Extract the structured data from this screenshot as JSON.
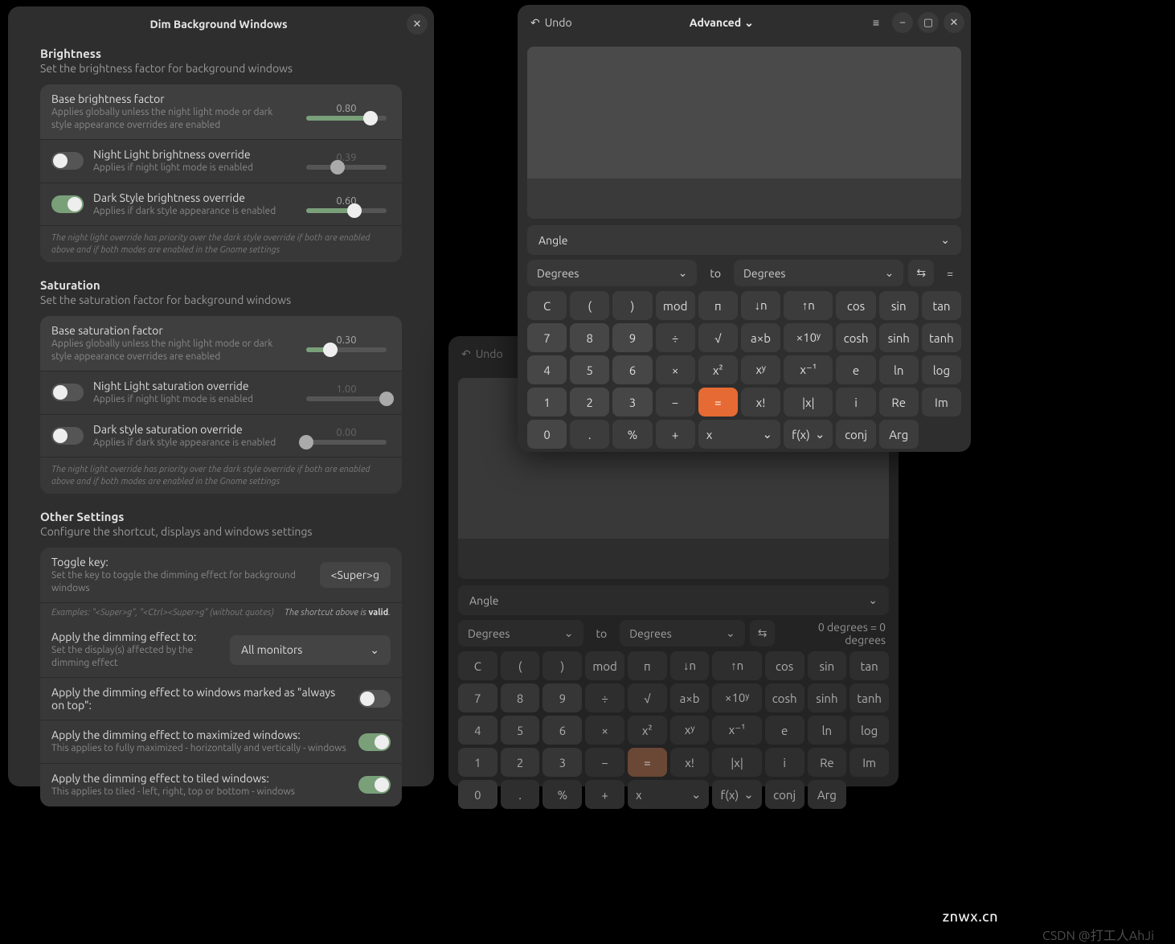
{
  "settings_window": {
    "title": "Dim Background Windows",
    "brightness": {
      "heading": "Brightness",
      "sub": "Set the brightness factor for background windows",
      "base": {
        "label": "Base brightness factor",
        "desc": "Applies globally unless the night light mode or dark style appearance overrides are enabled",
        "value": "0.80",
        "pct": 80
      },
      "night": {
        "label": "Night Light brightness override",
        "desc": "Applies if night light mode is enabled",
        "value": "0.39",
        "pct": 39,
        "toggle": false
      },
      "dark": {
        "label": "Dark Style brightness override",
        "desc": "Applies if dark style appearance is enabled",
        "value": "0.60",
        "pct": 60,
        "toggle": true
      },
      "note": "The night light override has priority over the dark style override if both are enabled above and if both modes are enabled in the Gnome settings"
    },
    "saturation": {
      "heading": "Saturation",
      "sub": "Set the saturation factor for background windows",
      "base": {
        "label": "Base saturation factor",
        "desc": "Applies globally unless the night light mode or dark style appearance overrides are enabled",
        "value": "0.30",
        "pct": 30
      },
      "night": {
        "label": "Night Light saturation override",
        "desc": "Applies if night light mode is enabled",
        "value": "1.00",
        "pct": 100,
        "toggle": false
      },
      "dark": {
        "label": "Dark style saturation override",
        "desc": "Applies if dark style appearance is enabled",
        "value": "0.00",
        "pct": 0,
        "toggle": false
      },
      "note": "The night light override has priority over the dark style override if both are enabled above and if both modes are enabled in the Gnome settings"
    },
    "other": {
      "heading": "Other Settings",
      "sub": "Configure the shortcut, displays and windows settings",
      "toggle_key": {
        "label": "Toggle key:",
        "desc": "Set the key to toggle the dimming effect for background windows",
        "value": "<Super>g"
      },
      "examples": "Examples: \"<Super>g\", \"<Ctrl><Super>g\" (without quotes)",
      "valid_prefix": "The shortcut above is ",
      "valid_word": "valid",
      "apply_to": {
        "label": "Apply the dimming effect to:",
        "desc": "Set the display(s) affected by the dimming effect",
        "value": "All monitors"
      },
      "always_on_top": {
        "label": "Apply the dimming effect to windows marked as \"always on top\":",
        "toggle": false
      },
      "maximized": {
        "label": "Apply the dimming effect to maximized windows:",
        "desc": "This applies to fully maximized - horizontally and vertically - windows",
        "toggle": true
      },
      "tiled": {
        "label": "Apply the dimming effect to tiled windows:",
        "desc": "This applies to tiled - left, right, top or bottom - windows",
        "toggle": true
      }
    }
  },
  "calc_front": {
    "undo": "Undo",
    "mode": "Advanced",
    "angle": "Angle",
    "from": "Degrees",
    "to_label": "to",
    "to": "Degrees",
    "swap": "⇆",
    "eq": "=",
    "keys": [
      [
        "C",
        "(",
        ")",
        "mod",
        "π",
        "↓n",
        "↑n",
        "cos",
        "sin",
        "tan"
      ],
      [
        "7",
        "8",
        "9",
        "÷",
        "√",
        "a×b",
        "×10ʸ",
        "cosh",
        "sinh",
        "tanh"
      ],
      [
        "4",
        "5",
        "6",
        "×",
        "x²",
        "xʸ",
        "x⁻¹",
        "e",
        "ln",
        "log"
      ],
      [
        "1",
        "2",
        "3",
        "−",
        "=",
        "x!",
        "|x|",
        "i",
        "Re",
        "Im"
      ],
      [
        "0",
        ".",
        "%",
        "+",
        "",
        "x",
        "",
        "f(x)",
        "conj",
        "Arg"
      ]
    ]
  },
  "calc_back": {
    "undo": "Undo",
    "angle": "Angle",
    "from": "Degrees",
    "to_label": "to",
    "to": "Degrees",
    "result": "0 degrees  =  0 degrees",
    "keys": [
      [
        "C",
        "(",
        ")",
        "mod",
        "π",
        "↓n",
        "↑n",
        "cos",
        "sin",
        "tan"
      ],
      [
        "7",
        "8",
        "9",
        "÷",
        "√",
        "a×b",
        "×10ʸ",
        "cosh",
        "sinh",
        "tanh"
      ],
      [
        "4",
        "5",
        "6",
        "×",
        "x²",
        "xʸ",
        "x⁻¹",
        "e",
        "ln",
        "log"
      ],
      [
        "1",
        "2",
        "3",
        "−",
        "=",
        "x!",
        "|x|",
        "i",
        "Re",
        "Im"
      ],
      [
        "0",
        ".",
        "%",
        "+",
        "",
        "x",
        "",
        "f(x)",
        "conj",
        "Arg"
      ]
    ]
  },
  "watermark1": "znwx.cn",
  "watermark2": "CSDN @打工人AhJi"
}
